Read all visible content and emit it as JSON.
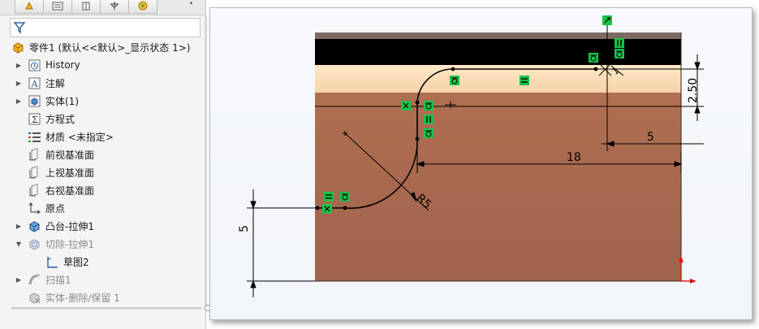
{
  "tree": {
    "part_label": "零件1  (默认<<默认>_显示状态 1>)",
    "items": [
      {
        "label": "History",
        "icon": "history-icon",
        "expandable": true,
        "dim": false
      },
      {
        "label": "注解",
        "icon": "annotations-icon",
        "expandable": true,
        "dim": false
      },
      {
        "label": "实体(1)",
        "icon": "solid-bodies-icon",
        "expandable": true,
        "dim": false
      },
      {
        "label": "方程式",
        "icon": "equations-icon",
        "expandable": false,
        "dim": false
      },
      {
        "label": "材质 <未指定>",
        "icon": "material-icon",
        "expandable": false,
        "dim": false
      },
      {
        "label": "前视基准面",
        "icon": "plane-icon",
        "expandable": false,
        "dim": false
      },
      {
        "label": "上视基准面",
        "icon": "plane-icon",
        "expandable": false,
        "dim": false
      },
      {
        "label": "右视基准面",
        "icon": "plane-icon",
        "expandable": false,
        "dim": false
      },
      {
        "label": "原点",
        "icon": "origin-icon",
        "expandable": false,
        "dim": false
      },
      {
        "label": "凸台-拉伸1",
        "icon": "boss-extrude-icon",
        "expandable": true,
        "dim": false
      },
      {
        "label": "切除-拉伸1",
        "icon": "cut-extrude-icon",
        "expandable": true,
        "expanded": true,
        "dim": true
      },
      {
        "label": "草图2",
        "icon": "sketch-icon",
        "expandable": false,
        "dim": false,
        "child": true
      },
      {
        "label": "扫描1",
        "icon": "sweep-icon",
        "expandable": true,
        "dim": true
      },
      {
        "label": "实体-删除/保留 1",
        "icon": "body-delete-icon",
        "expandable": false,
        "dim": true
      }
    ]
  },
  "viewport": {
    "dimensions": {
      "height_top": "2.50",
      "offset_5": "5",
      "width_18": "18",
      "radius": "R5",
      "height_left": "5"
    }
  },
  "colors": {
    "relation_green": "#19c24a",
    "part_top": "#000000",
    "part_body": "#a5684f",
    "dimension_line": "#000000"
  }
}
